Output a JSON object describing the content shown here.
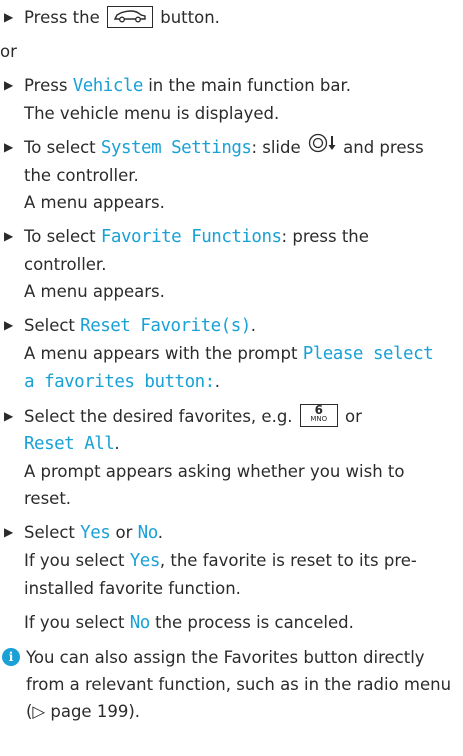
{
  "steps": {
    "s1": {
      "pre": "Press the",
      "key": "car-key",
      "post": "button."
    },
    "or": "or",
    "s2": {
      "pre": "Press",
      "highlight": "Vehicle",
      "post": "in the main function bar.",
      "result": "The vehicle menu is displayed."
    },
    "s3": {
      "pre": "To select",
      "highlight": "System Settings",
      "mid": ": slide",
      "post": "and press the controller.",
      "result": "A menu appears."
    },
    "s4": {
      "pre": "To select",
      "highlight": "Favorite Functions",
      "post": ": press the controller.",
      "result": "A menu appears."
    },
    "s5": {
      "pre": "Select",
      "highlight": "Reset Favorite(s)",
      "post": ".",
      "result_pre": "A menu appears with the prompt",
      "prompt": "Please select a favorites button:",
      "result_post": "."
    },
    "s6": {
      "pre": "Select the desired favorites, e.g.",
      "key_number": "6",
      "key_letters": "MNO",
      "mid": "or",
      "highlight": "Reset All",
      "post": ".",
      "result": "A prompt appears asking whether you wish to reset."
    },
    "s7": {
      "pre": "Select",
      "yes": "Yes",
      "mid": "or",
      "no": "No",
      "post": ".",
      "r1_pre": "If you select",
      "r1_yes": "Yes",
      "r1_post": ", the favorite is reset to its pre-installed favorite function.",
      "r2_pre": "If you select",
      "r2_no": "No",
      "r2_post": "the process is canceled."
    }
  },
  "info": {
    "icon": "i",
    "text": "You can also assign the Favorites button directly from a relevant function, such as in the radio menu (▷ page 199)."
  },
  "colors": {
    "highlight": "#1aa1d6",
    "text": "#2b2b2b"
  }
}
